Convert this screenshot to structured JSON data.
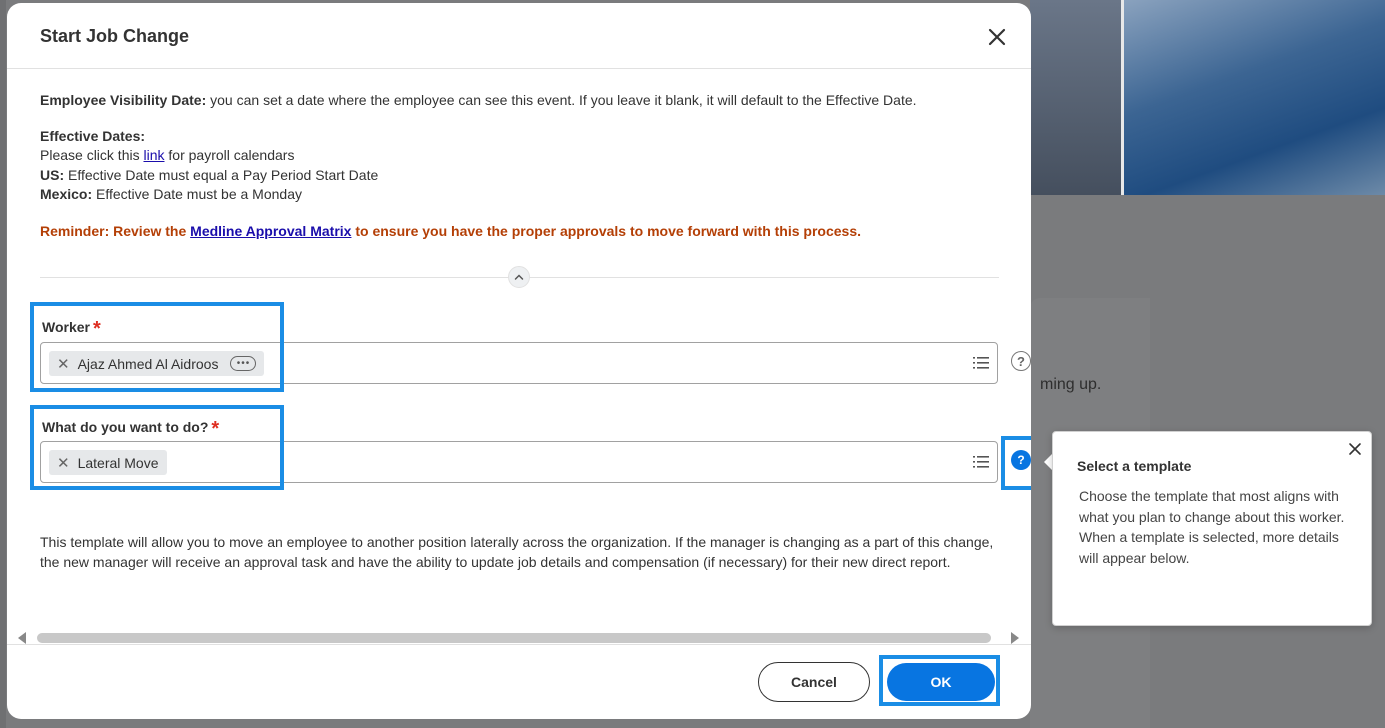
{
  "background": {
    "partial_text": "ming up."
  },
  "modal": {
    "title": "Start Job Change",
    "visibility_label": "Employee Visibility Date:",
    "visibility_text": " you can set a date where the employee can see this event. If you leave it blank, it will default to the Effective Date.",
    "effective_label": "Effective Dates:",
    "payroll_prefix": "Please click this ",
    "payroll_link": "link",
    "payroll_suffix": " for payroll calendars",
    "us_label": "US:",
    "us_text": " Effective Date must equal a Pay Period Start Date",
    "mexico_label": "Mexico:",
    "mexico_text": " Effective Date must be a Monday",
    "reminder_prefix": "Reminder: Review the ",
    "reminder_link": "Medline Approval Matrix",
    "reminder_suffix": " to ensure you have the proper approvals to move forward with this process.",
    "worker_label": "Worker",
    "worker_value": "Ajaz Ahmed Al Aidroos",
    "todo_label": "What do you want to do?",
    "todo_value": "Lateral Move",
    "required_mark": "*",
    "description": "This template will allow you to move an employee to another position laterally across the organization. If the manager is changing as a part of this change, the new manager will receive an approval task and have the ability to update job details and compensation (if necessary) for their new direct report.",
    "cancel_label": "Cancel",
    "ok_label": "OK"
  },
  "popup": {
    "title": "Select a template",
    "body": "Choose the template that most aligns with what you plan to change about this worker. When a template is selected, more details will appear below."
  },
  "icons": {
    "close": "close-icon",
    "list": "list-icon",
    "help": "help-icon",
    "more": "more-icon"
  },
  "colors": {
    "primary": "#0875e1",
    "highlight": "#1a8de5",
    "required": "#de2e21",
    "reminder": "#b43f06",
    "link": "#1a0dab"
  }
}
